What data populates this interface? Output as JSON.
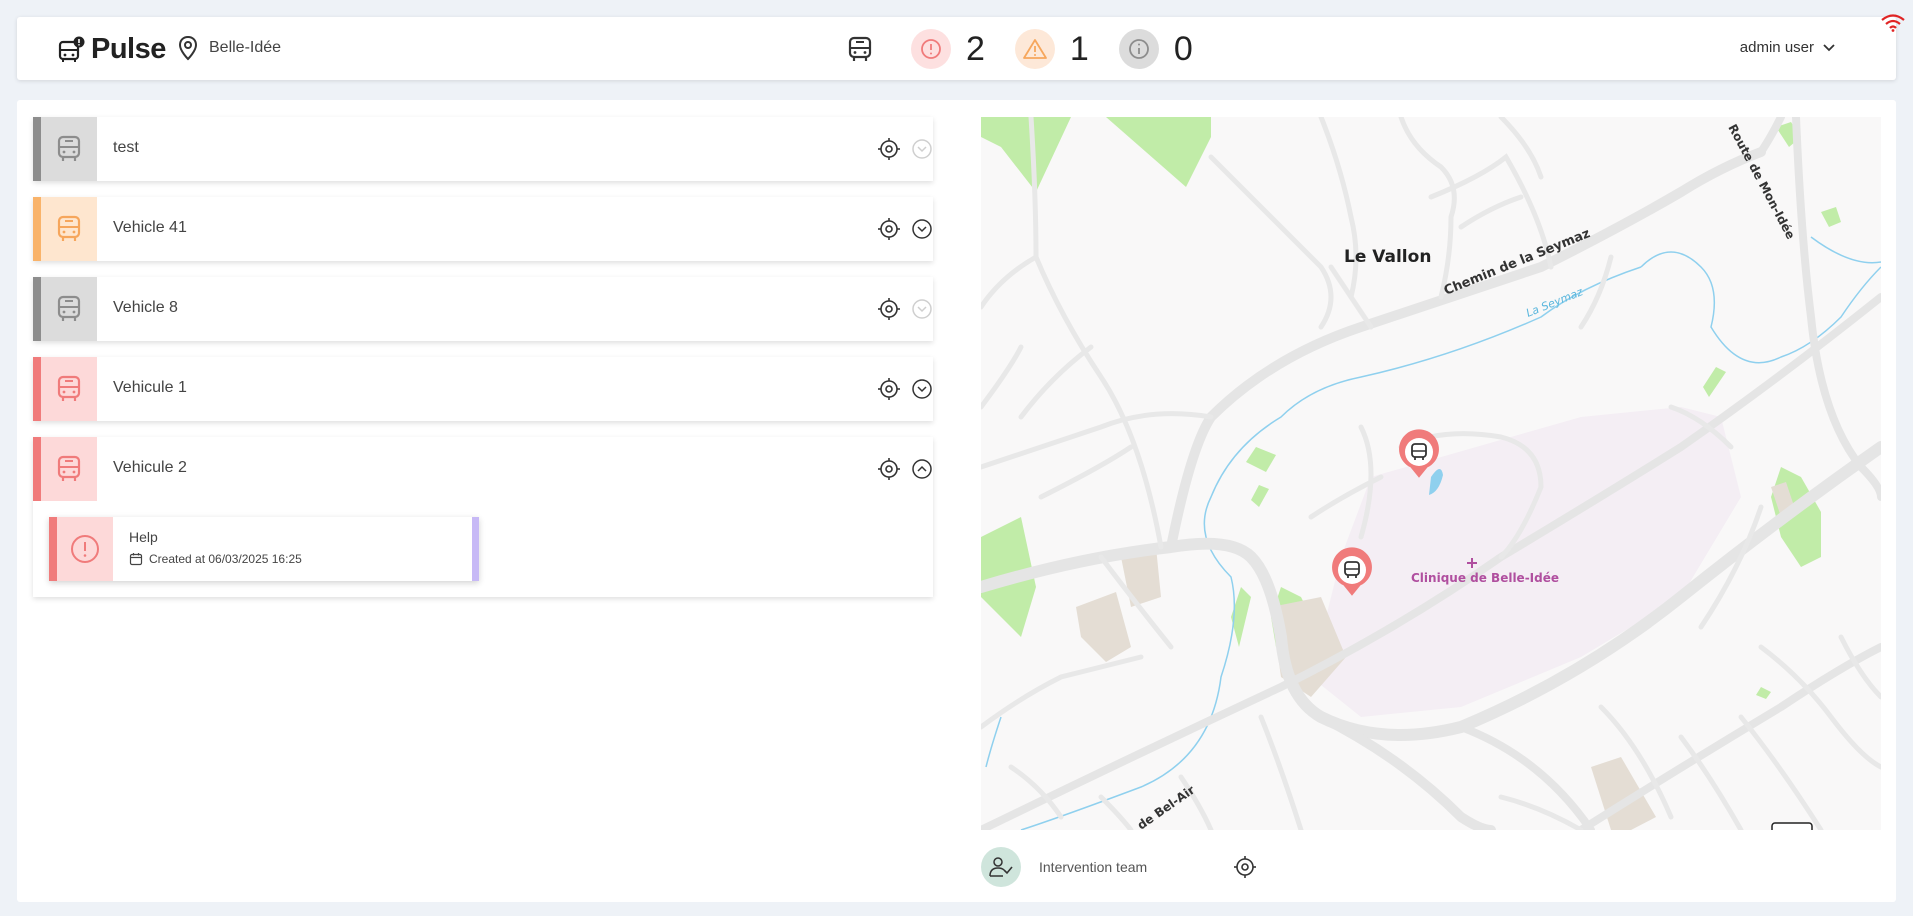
{
  "header": {
    "app_name": "Pulse",
    "location": "Belle-Idée",
    "counters": [
      {
        "name": "critical",
        "value": "2",
        "bg": "#fde0e0",
        "color": "#f07b7b"
      },
      {
        "name": "warning",
        "value": "1",
        "bg": "#fde8d8",
        "color": "#f6a65c"
      },
      {
        "name": "info",
        "value": "0",
        "bg": "#dcdcdc",
        "color": "#9a9a9a"
      }
    ],
    "user": "admin user"
  },
  "vehicles": [
    {
      "name": "test",
      "status": "inactive",
      "strip": "#8d8d8d",
      "icon_bg": "#dcdcdc",
      "icon_color": "#8d8d8d",
      "expanded": false,
      "has_alerts": false
    },
    {
      "name": "Vehicle 41",
      "status": "warning",
      "strip": "#f9b36a",
      "icon_bg": "#fee6cf",
      "icon_color": "#f6a65c",
      "expanded": false,
      "has_alerts": true
    },
    {
      "name": "Vehicle 8",
      "status": "inactive",
      "strip": "#8d8d8d",
      "icon_bg": "#dcdcdc",
      "icon_color": "#8d8d8d",
      "expanded": false,
      "has_alerts": false
    },
    {
      "name": "Vehicule 1",
      "status": "critical",
      "strip": "#f07b7b",
      "icon_bg": "#fdd9d9",
      "icon_color": "#f07b7b",
      "expanded": false,
      "has_alerts": true
    },
    {
      "name": "Vehicule 2",
      "status": "critical",
      "strip": "#f07b7b",
      "icon_bg": "#fdd9d9",
      "icon_color": "#f07b7b",
      "expanded": true,
      "has_alerts": true
    }
  ],
  "alert": {
    "title": "Help",
    "created": "Created at 06/03/2025 16:25"
  },
  "map": {
    "labels": {
      "le_vallon": "Le Vallon",
      "chemin_seymaz": "Chemin de la Seymaz",
      "la_seymaz": "La Seymaz",
      "route_mon_idee": "Route de Mon-Idée",
      "clinique": "Clinique de Belle-Idée",
      "bel_air": "de Bel-Air"
    },
    "marker_icon": "bus-icon"
  },
  "team": {
    "label": "Intervention team"
  }
}
